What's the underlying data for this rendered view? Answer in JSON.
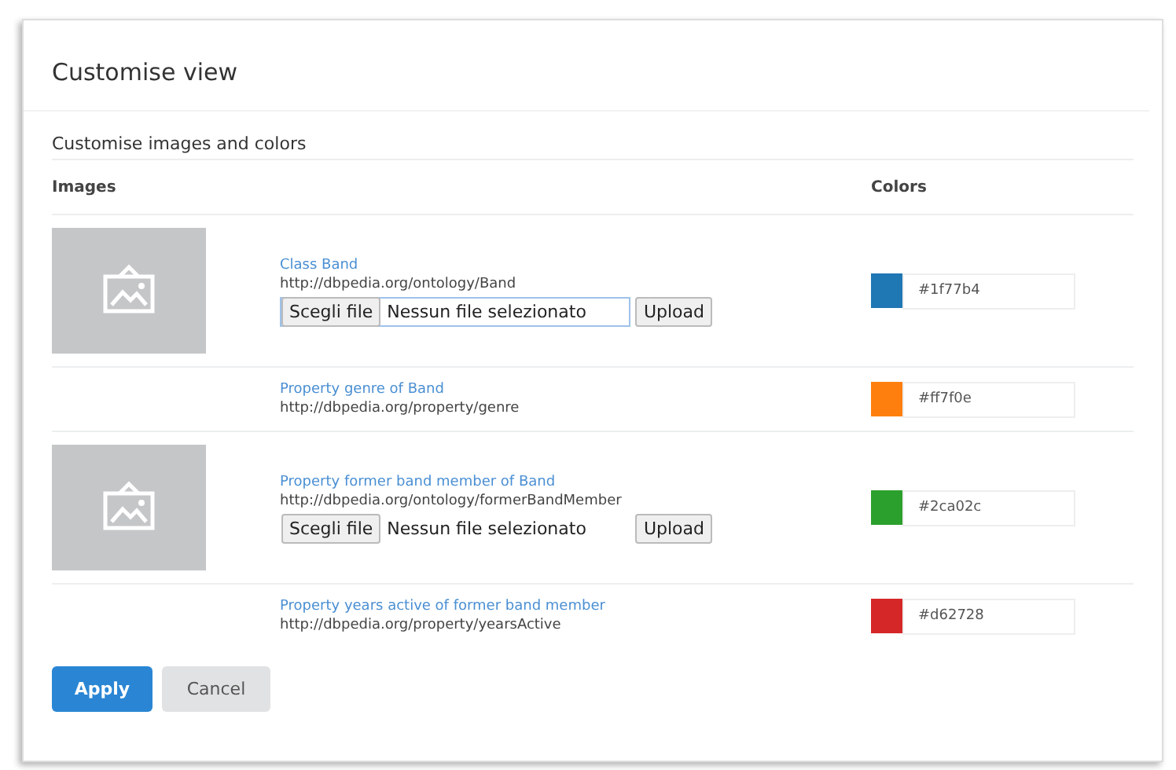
{
  "dialog": {
    "title": "Customise view",
    "section": "Customise images and colors",
    "columns": [
      "Images",
      "Colors"
    ],
    "rows": [
      {
        "image": true,
        "label": "Class Band",
        "uri": "http://dbpedia.org/ontology/Band",
        "file_input": {
          "button": "Scegli file",
          "text": "Nessun file selezionato",
          "upload": "Upload",
          "focused": true
        },
        "color": "#1f77b4",
        "color_text": "#1f77b4"
      },
      {
        "image": false,
        "label": "Property genre of Band",
        "uri": "http://dbpedia.org/property/genre",
        "color": "#ff7f0e",
        "color_text": "#ff7f0e"
      },
      {
        "image": true,
        "label": "Property former band member of Band",
        "uri": "http://dbpedia.org/ontology/formerBandMember",
        "file_input": {
          "button": "Scegli file",
          "text": "Nessun file selezionato",
          "upload": "Upload",
          "focused": false
        },
        "color": "#2ca02c",
        "color_text": "#2ca02c"
      },
      {
        "image": false,
        "label": "Property years active of former band member",
        "uri": "http://dbpedia.org/property/yearsActive",
        "color": "#d62728",
        "color_text": "#d62728"
      }
    ],
    "buttons": [
      {
        "label": "Apply",
        "kind": "primary"
      },
      {
        "label": "Cancel",
        "kind": "secondary"
      }
    ]
  }
}
